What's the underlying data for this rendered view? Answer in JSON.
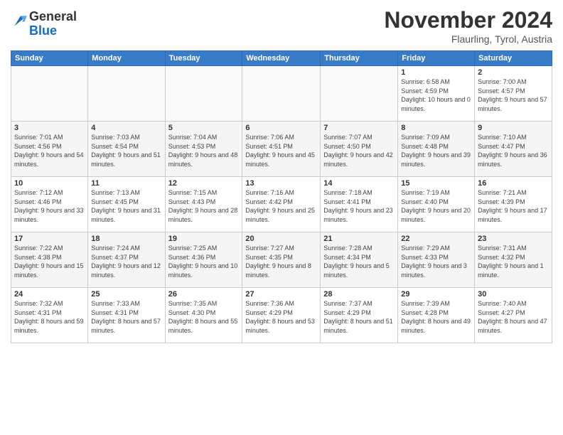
{
  "logo": {
    "general": "General",
    "blue": "Blue"
  },
  "header": {
    "title": "November 2024",
    "location": "Flaurling, Tyrol, Austria"
  },
  "weekdays": [
    "Sunday",
    "Monday",
    "Tuesday",
    "Wednesday",
    "Thursday",
    "Friday",
    "Saturday"
  ],
  "weeks": [
    [
      {
        "day": "",
        "info": ""
      },
      {
        "day": "",
        "info": ""
      },
      {
        "day": "",
        "info": ""
      },
      {
        "day": "",
        "info": ""
      },
      {
        "day": "",
        "info": ""
      },
      {
        "day": "1",
        "info": "Sunrise: 6:58 AM\nSunset: 4:59 PM\nDaylight: 10 hours and 0 minutes."
      },
      {
        "day": "2",
        "info": "Sunrise: 7:00 AM\nSunset: 4:57 PM\nDaylight: 9 hours and 57 minutes."
      }
    ],
    [
      {
        "day": "3",
        "info": "Sunrise: 7:01 AM\nSunset: 4:56 PM\nDaylight: 9 hours and 54 minutes."
      },
      {
        "day": "4",
        "info": "Sunrise: 7:03 AM\nSunset: 4:54 PM\nDaylight: 9 hours and 51 minutes."
      },
      {
        "day": "5",
        "info": "Sunrise: 7:04 AM\nSunset: 4:53 PM\nDaylight: 9 hours and 48 minutes."
      },
      {
        "day": "6",
        "info": "Sunrise: 7:06 AM\nSunset: 4:51 PM\nDaylight: 9 hours and 45 minutes."
      },
      {
        "day": "7",
        "info": "Sunrise: 7:07 AM\nSunset: 4:50 PM\nDaylight: 9 hours and 42 minutes."
      },
      {
        "day": "8",
        "info": "Sunrise: 7:09 AM\nSunset: 4:48 PM\nDaylight: 9 hours and 39 minutes."
      },
      {
        "day": "9",
        "info": "Sunrise: 7:10 AM\nSunset: 4:47 PM\nDaylight: 9 hours and 36 minutes."
      }
    ],
    [
      {
        "day": "10",
        "info": "Sunrise: 7:12 AM\nSunset: 4:46 PM\nDaylight: 9 hours and 33 minutes."
      },
      {
        "day": "11",
        "info": "Sunrise: 7:13 AM\nSunset: 4:45 PM\nDaylight: 9 hours and 31 minutes."
      },
      {
        "day": "12",
        "info": "Sunrise: 7:15 AM\nSunset: 4:43 PM\nDaylight: 9 hours and 28 minutes."
      },
      {
        "day": "13",
        "info": "Sunrise: 7:16 AM\nSunset: 4:42 PM\nDaylight: 9 hours and 25 minutes."
      },
      {
        "day": "14",
        "info": "Sunrise: 7:18 AM\nSunset: 4:41 PM\nDaylight: 9 hours and 23 minutes."
      },
      {
        "day": "15",
        "info": "Sunrise: 7:19 AM\nSunset: 4:40 PM\nDaylight: 9 hours and 20 minutes."
      },
      {
        "day": "16",
        "info": "Sunrise: 7:21 AM\nSunset: 4:39 PM\nDaylight: 9 hours and 17 minutes."
      }
    ],
    [
      {
        "day": "17",
        "info": "Sunrise: 7:22 AM\nSunset: 4:38 PM\nDaylight: 9 hours and 15 minutes."
      },
      {
        "day": "18",
        "info": "Sunrise: 7:24 AM\nSunset: 4:37 PM\nDaylight: 9 hours and 12 minutes."
      },
      {
        "day": "19",
        "info": "Sunrise: 7:25 AM\nSunset: 4:36 PM\nDaylight: 9 hours and 10 minutes."
      },
      {
        "day": "20",
        "info": "Sunrise: 7:27 AM\nSunset: 4:35 PM\nDaylight: 9 hours and 8 minutes."
      },
      {
        "day": "21",
        "info": "Sunrise: 7:28 AM\nSunset: 4:34 PM\nDaylight: 9 hours and 5 minutes."
      },
      {
        "day": "22",
        "info": "Sunrise: 7:29 AM\nSunset: 4:33 PM\nDaylight: 9 hours and 3 minutes."
      },
      {
        "day": "23",
        "info": "Sunrise: 7:31 AM\nSunset: 4:32 PM\nDaylight: 9 hours and 1 minute."
      }
    ],
    [
      {
        "day": "24",
        "info": "Sunrise: 7:32 AM\nSunset: 4:31 PM\nDaylight: 8 hours and 59 minutes."
      },
      {
        "day": "25",
        "info": "Sunrise: 7:33 AM\nSunset: 4:31 PM\nDaylight: 8 hours and 57 minutes."
      },
      {
        "day": "26",
        "info": "Sunrise: 7:35 AM\nSunset: 4:30 PM\nDaylight: 8 hours and 55 minutes."
      },
      {
        "day": "27",
        "info": "Sunrise: 7:36 AM\nSunset: 4:29 PM\nDaylight: 8 hours and 53 minutes."
      },
      {
        "day": "28",
        "info": "Sunrise: 7:37 AM\nSunset: 4:29 PM\nDaylight: 8 hours and 51 minutes."
      },
      {
        "day": "29",
        "info": "Sunrise: 7:39 AM\nSunset: 4:28 PM\nDaylight: 8 hours and 49 minutes."
      },
      {
        "day": "30",
        "info": "Sunrise: 7:40 AM\nSunset: 4:27 PM\nDaylight: 8 hours and 47 minutes."
      }
    ]
  ]
}
